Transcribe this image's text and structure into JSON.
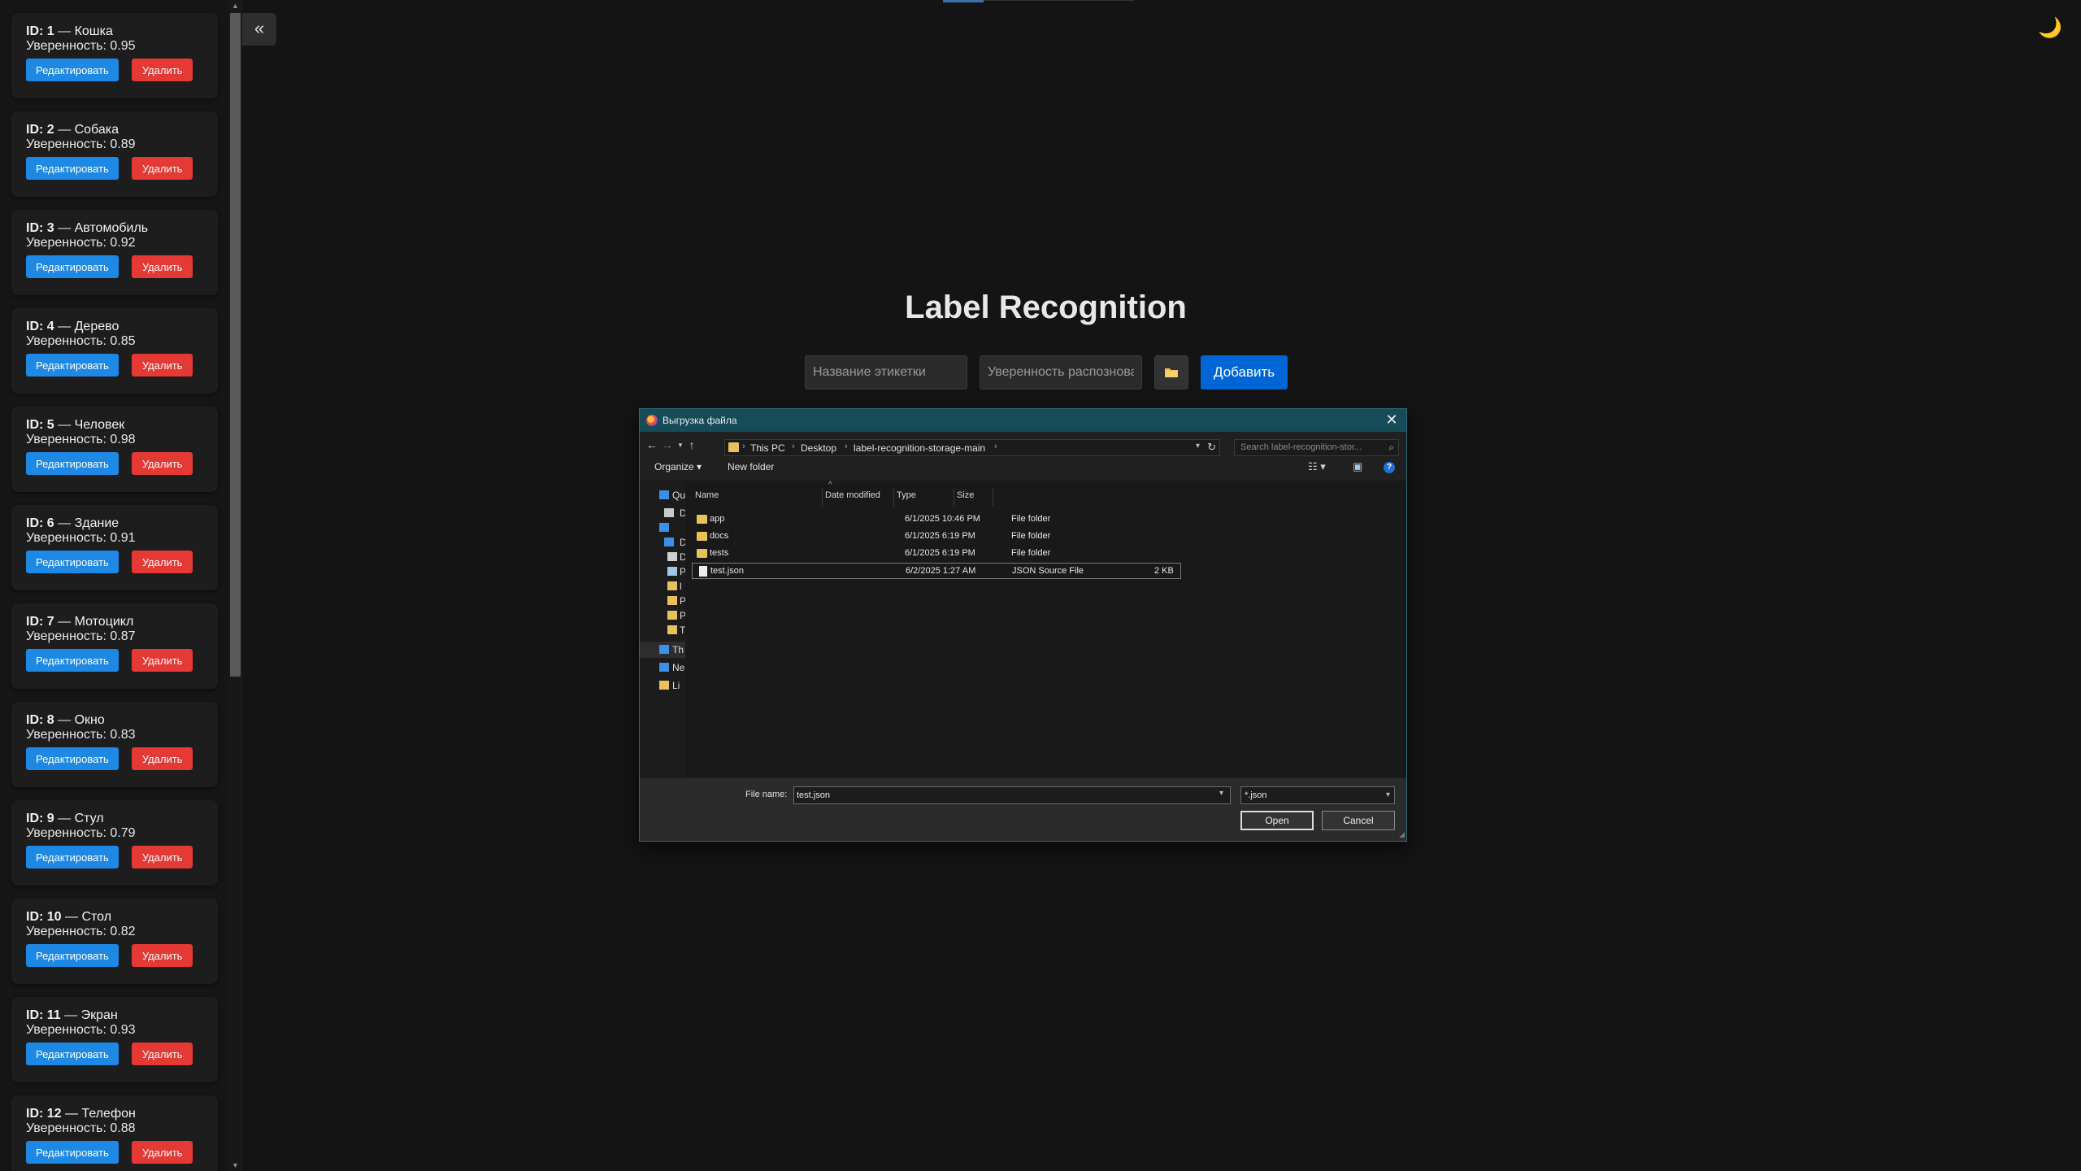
{
  "sidebar": {
    "id_prefix": "ID:",
    "confidence_prefix": "Уверенность:",
    "edit_label": "Редактировать",
    "delete_label": "Удалить",
    "items": [
      {
        "id": "1",
        "name": "— Кошка",
        "confidence": "0.95"
      },
      {
        "id": "2",
        "name": "— Собака",
        "confidence": "0.89"
      },
      {
        "id": "3",
        "name": "— Автомобиль",
        "confidence": "0.92"
      },
      {
        "id": "4",
        "name": "— Дерево",
        "confidence": "0.85"
      },
      {
        "id": "5",
        "name": "— Человек",
        "confidence": "0.98"
      },
      {
        "id": "6",
        "name": "— Здание",
        "confidence": "0.91"
      },
      {
        "id": "7",
        "name": "— Мотоцикл",
        "confidence": "0.87"
      },
      {
        "id": "8",
        "name": "— Окно",
        "confidence": "0.83"
      },
      {
        "id": "9",
        "name": "— Стул",
        "confidence": "0.79"
      },
      {
        "id": "10",
        "name": "— Стол",
        "confidence": "0.82"
      },
      {
        "id": "11",
        "name": "— Экран",
        "confidence": "0.93"
      },
      {
        "id": "12",
        "name": "— Телефон",
        "confidence": "0.88"
      }
    ]
  },
  "collapse_icon": "«",
  "theme_icon": "🌙",
  "main": {
    "title": "Label Recognition",
    "name_placeholder": "Название этикетки",
    "confidence_placeholder": "Уверенность распознова",
    "add_label": "Добавить"
  },
  "dialog": {
    "title": "Выгрузка файла",
    "breadcrumbs": [
      "This PC",
      "Desktop",
      "label-recognition-storage-main"
    ],
    "search_placeholder": "Search label-recognition-stor...",
    "organize_label": "Organize ▾",
    "new_folder_label": "New folder",
    "help_label": "?",
    "nav_pane": [
      {
        "label": "Qu",
        "icon": "star-icon",
        "color": "#3d8fe8"
      },
      {
        "label": "D",
        "icon": "desktop-shortcut-icon",
        "color": "#c9c9c9"
      },
      {
        "label": "",
        "icon": "desktop-icon",
        "color": "#3d8fe8"
      },
      {
        "label": "D",
        "icon": "download-icon",
        "color": "#3d8fe8"
      },
      {
        "label": "D",
        "icon": "documents-icon",
        "color": "#cfcfcf"
      },
      {
        "label": "P",
        "icon": "pictures-icon",
        "color": "#9ec7e8"
      },
      {
        "label": "l",
        "icon": "folder-icon",
        "color": "#e8c15a"
      },
      {
        "label": "P",
        "icon": "folder-icon",
        "color": "#e8c15a"
      },
      {
        "label": "P",
        "icon": "folder-icon",
        "color": "#e8c15a"
      },
      {
        "label": "T",
        "icon": "folder-icon",
        "color": "#e8c15a"
      },
      {
        "label": "Th",
        "icon": "this-pc-icon",
        "color": "#3d8fe8"
      },
      {
        "label": "Ne",
        "icon": "network-icon",
        "color": "#3d8fe8"
      },
      {
        "label": "Li",
        "icon": "linux-icon",
        "color": "#e8c15a"
      }
    ],
    "columns": {
      "name": "Name",
      "date": "Date modified",
      "type": "Type",
      "size": "Size"
    },
    "files": [
      {
        "name": "app",
        "date": "6/1/2025 10:46 PM",
        "type": "File folder",
        "size": "",
        "kind": "folder"
      },
      {
        "name": "docs",
        "date": "6/1/2025 6:19 PM",
        "type": "File folder",
        "size": "",
        "kind": "folder"
      },
      {
        "name": "tests",
        "date": "6/1/2025 6:19 PM",
        "type": "File folder",
        "size": "",
        "kind": "folder"
      },
      {
        "name": "test.json",
        "date": "6/2/2025 1:27 AM",
        "type": "JSON Source File",
        "size": "2 KB",
        "kind": "file"
      }
    ],
    "file_name_label": "File name:",
    "file_name_value": "test.json",
    "file_type_value": "*.json",
    "open_label": "Open",
    "cancel_label": "Cancel"
  }
}
